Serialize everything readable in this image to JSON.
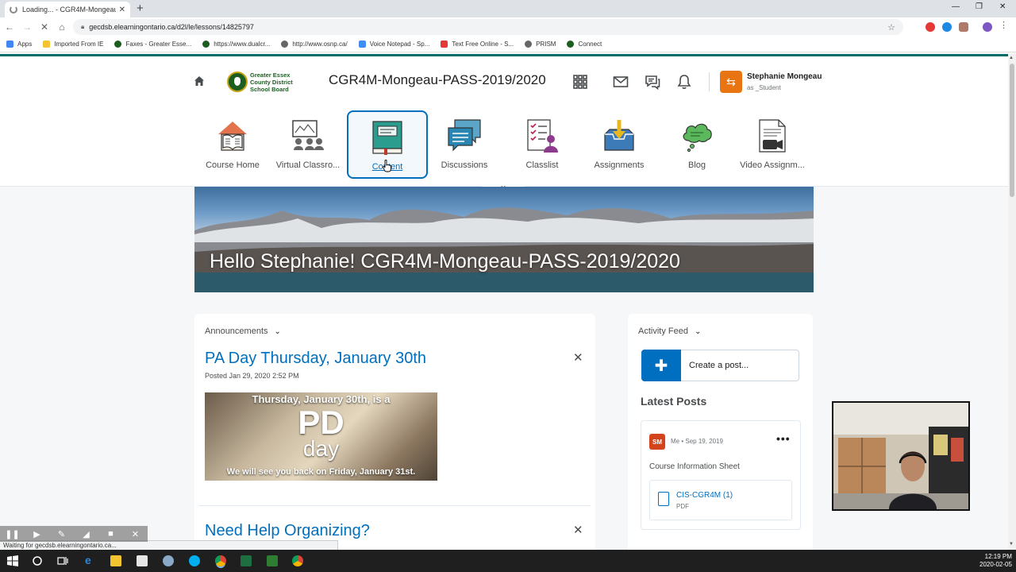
{
  "browser": {
    "tab_title": "Loading... - CGR4M-Mongeau-PA",
    "url": "gecdsb.elearningontario.ca/d2l/le/lessons/14825797",
    "bookmarks": [
      "Apps",
      "Imported From IE",
      "Faxes - Greater Esse...",
      "https://www.dualcr...",
      "http://www.osnp.ca/",
      "Voice Notepad - Sp...",
      "Text Free Online - S...",
      "PRISM",
      "Connect"
    ],
    "status_text": "Waiting for gecdsb.elearningontario.ca..."
  },
  "minibar": {
    "logo_text": "Greater Essex County District School Board",
    "course_title": "CGR4M-Mongeau-PASS-2019/2020",
    "user_name": "Stephanie Mongeau",
    "user_role": "as _Student"
  },
  "nav": {
    "items": [
      {
        "label": "Course Home",
        "icon": "course-home-icon"
      },
      {
        "label": "Virtual Classro...",
        "icon": "virtual-classroom-icon"
      },
      {
        "label": "Content",
        "icon": "content-book-icon",
        "active": true
      },
      {
        "label": "Discussions",
        "icon": "discussions-icon"
      },
      {
        "label": "Classlist",
        "icon": "classlist-icon"
      },
      {
        "label": "Assignments",
        "icon": "assignments-icon"
      },
      {
        "label": "Blog",
        "icon": "blog-icon"
      },
      {
        "label": "Video Assignm...",
        "icon": "video-assignment-icon"
      }
    ]
  },
  "banner": {
    "title": "Hello Stephanie! CGR4M-Mongeau-PASS-2019/2020"
  },
  "announcements": {
    "header": "Announcements",
    "first": {
      "title": "PA Day Thursday, January 30th",
      "posted": "Posted Jan 29, 2020 2:52 PM",
      "image_line1": "Thursday, January 30th, is a",
      "image_big": "PD",
      "image_small": "day",
      "image_line2": "We will see you back on Friday, January 31st."
    },
    "second": {
      "title": "Need Help Organizing?"
    }
  },
  "activity": {
    "header": "Activity Feed",
    "create_placeholder": "Create a post...",
    "latest_posts": "Latest Posts",
    "post": {
      "avatar": "SM",
      "meta": "Me • Sep 19, 2019",
      "title": "Course Information Sheet",
      "file_name": "CIS-CGR4M (1)",
      "file_type": "PDF"
    }
  },
  "taskbar": {
    "time": "12:19 PM",
    "date": "2020-02-05"
  },
  "colors": {
    "teal": "#006d66",
    "link_blue": "#006fbf",
    "avatar_orange": "#e87511",
    "sm_avatar": "#d4441c"
  }
}
